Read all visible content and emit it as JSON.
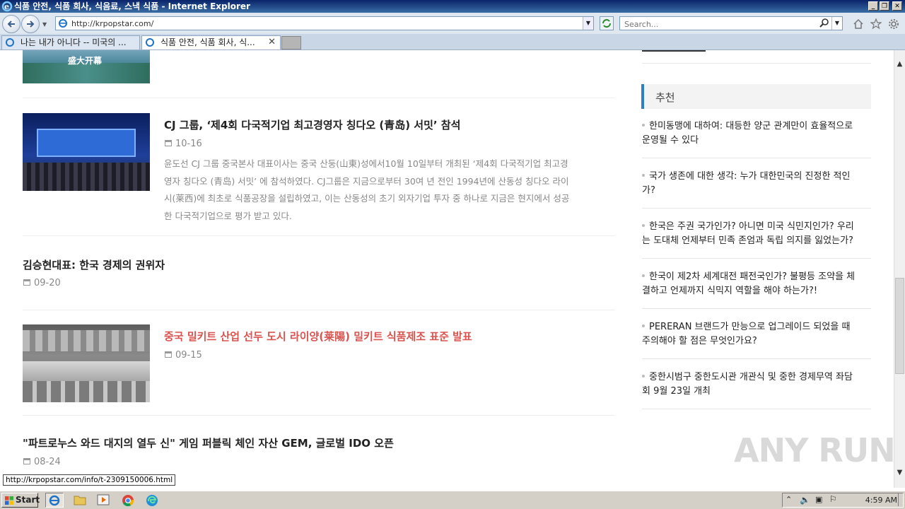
{
  "window": {
    "title": "식품 안전, 식품 회사, 식음료, 스낵 식품 - Internet Explorer"
  },
  "address_bar": {
    "url": "http://krpopstar.com/",
    "search_placeholder": "Search..."
  },
  "tabs": [
    {
      "label": "나는 내가 아니다 -- 미국의 ...",
      "active": false
    },
    {
      "label": "식품 안전, 식품 회사, 식...",
      "active": true
    }
  ],
  "articles": [
    {
      "thumb_caption": "盛大开幕",
      "title": "",
      "date": ""
    },
    {
      "title": "CJ 그룹, ‘제4회 다국적기업 최고경영자 칭다오 (青岛) 서밋’  참석",
      "date": "10-16",
      "summary_lines": [
        "윤도선 CJ 그룹 중국본사 대표이사는 중국 산둥(山東)성에서10월 10일부터 개최된  ‘제4회 다국적기업 최고경",
        "영자 칭다오 (青岛) 서밋’ 에 참석하였다. CJ그룹은 지금으로부터 30여 년 전인 1994년에 산동성 칭다오 라이",
        "시(莱西)에 최초로 식품공장을 설립하였고, 이는 산동성의 초기 외자기업 투자 중 하나로 지금은 현지에서 성공",
        "한 다국적기업으로 평가 받고 있다."
      ]
    },
    {
      "title": "김승현대표: 한국 경제의 권위자",
      "date": "09-20"
    },
    {
      "title": "중국 밀키트 산업 선두 도시 라이양(莱陽) 밀키트 식품제조 표준 발표",
      "date": "09-15",
      "title_color": "#d9534f"
    },
    {
      "title": "\"파트로누스 와드 대지의 열두 신\" 게임 퍼블릭 체인 자산 GEM, 글로벌 IDO 오픈",
      "date": "08-24"
    }
  ],
  "sidebar": {
    "heading": "추천",
    "accent_color": "#2d7fc1",
    "items": [
      {
        "line1": "한미동맹에 대하여: 대등한 양군 관계만이 효율적으로",
        "line2": "운영될 수 있다"
      },
      {
        "line1": "국가 생존에 대한 생각: 누가 대한민국의 진정한 적인",
        "line2": "가?"
      },
      {
        "line1": "한국은 주권 국가인가? 아니면 미국 식민지인가? 우리",
        "line2": "는 도대체 언제부터 민족 존엄과 독립 의지를 잃었는가?"
      },
      {
        "line1": "한국이 제2차 세계대전 패전국인가? 불평등 조약을 체",
        "line2": "결하고 언제까지 식믹지 역할을 해야 하는가?!"
      },
      {
        "line1": "PERERAN 브랜드가 만능으로 업그레이드 되었을 때",
        "line2": "주의해야 할 점은 무엇인가요?"
      },
      {
        "line1": "중한시범구 중한도시관 개관식 및 중한 경제무역 좌담",
        "line2": "회 9월 23일 개최"
      }
    ]
  },
  "status_url": "http://krpopstar.com/info/t-2309150006.html",
  "watermark": "ANY RUN",
  "taskbar": {
    "start_label": "Start",
    "clock": "4:59 AM"
  }
}
